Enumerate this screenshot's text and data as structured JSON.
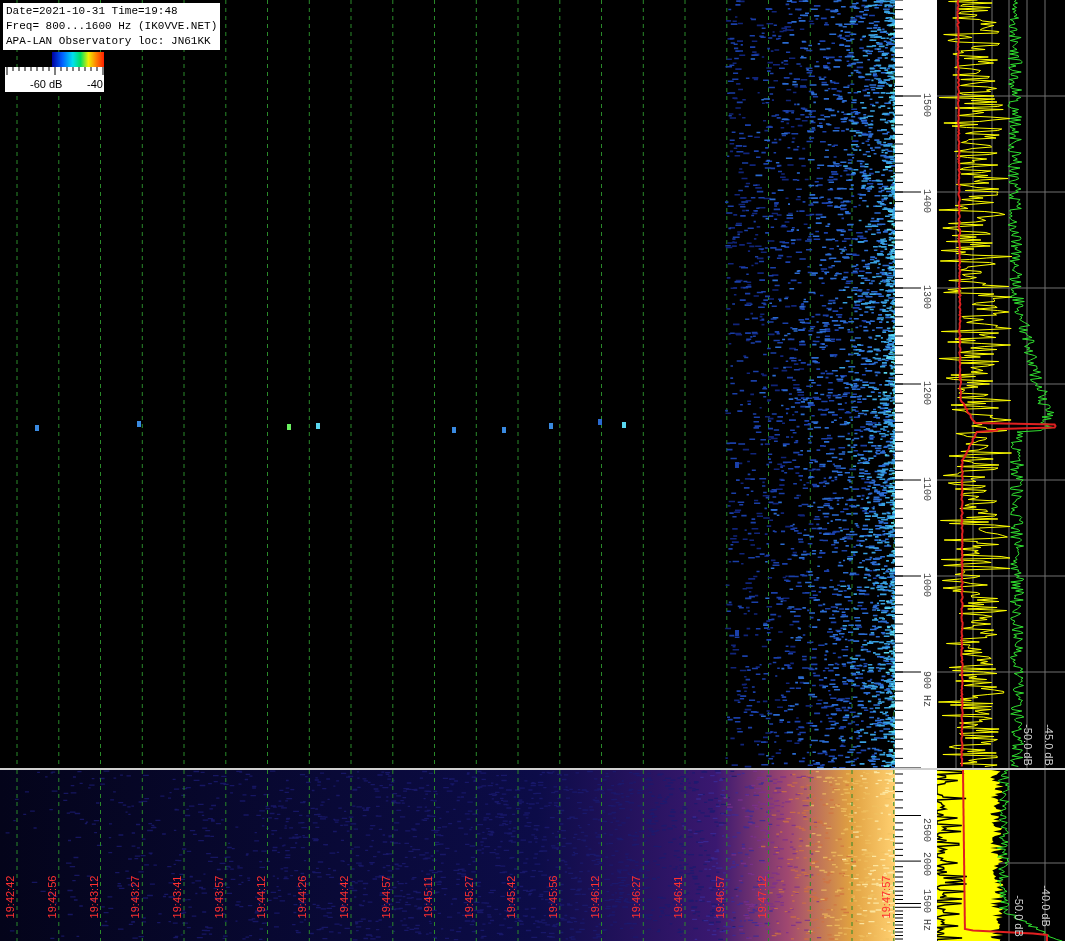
{
  "info_box": {
    "lines": [
      "Date=2021-10-31 Time=19:48",
      "Freq= 800...1600 Hz (IK0VVE.NET)",
      "APA-LAN Observatory loc: JN61KK"
    ]
  },
  "color_scale": {
    "labels": [
      "-60 dB",
      "-40"
    ]
  },
  "top_axis": {
    "frequency_labels": [
      "1500",
      "1400",
      "1300",
      "1200",
      "1100",
      "1000",
      "900 Hz"
    ]
  },
  "top_spectrum": {
    "db_labels": [
      "-50.0 dB",
      "-45.0 dB"
    ]
  },
  "bottom_waterfall": {
    "time_labels": [
      "19:42:42",
      "19:42:56",
      "19:43:12",
      "19:43:27",
      "19:43:41",
      "19:43:57",
      "19:44:12",
      "19:44:26",
      "19:44:42",
      "19:44:57",
      "19:45:11",
      "19:45:27",
      "19:45:42",
      "19:45:56",
      "19:46:12",
      "19:46:27",
      "19:46:41",
      "19:46:57",
      "19:47:12"
    ],
    "edge_time_label": "19:47:57"
  },
  "bottom_axis": {
    "frequency_labels": [
      "2500",
      "2000",
      "1500 Hz"
    ]
  },
  "bottom_spectrum": {
    "db_labels": [
      "-50.0 dB",
      "-40.0 dB"
    ]
  }
}
